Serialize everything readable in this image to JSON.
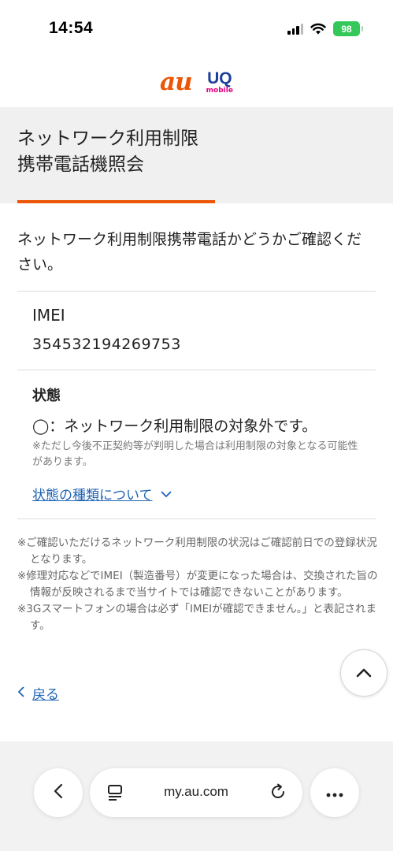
{
  "status_bar": {
    "time": "14:54",
    "battery": "98"
  },
  "header": {
    "au_logo": "au",
    "uq_logo": "UQ",
    "uq_sub": "mobile"
  },
  "page": {
    "title_line1": "ネットワーク利用制限",
    "title_line2": "携帯電話機照会",
    "intro": "ネットワーク利用制限携帯電話かどうかご確認ください。",
    "imei_label": "IMEI",
    "imei_value": "354532194269753",
    "state_label": "状態",
    "state_value": "◯：ネットワーク利用制限の対象外です。",
    "state_note": "※ただし今後不正契約等が判明した場合は利用制限の対象となる可能性があります。",
    "state_link": "状態の種類について",
    "notes": [
      "※ご確認いただけるネットワーク利用制限の状況はご確認前日での登録状況となります。",
      "※修理対応などでIMEI（製造番号）が変更になった場合は、交換された旨の情報が反映されるまで当サイトでは確認できないことがあります。",
      "※3Gスマートフォンの場合は必ず「IMEIが確認できません。」と表記されます。"
    ],
    "back_link": "戻る"
  },
  "browser": {
    "url": "my.au.com"
  },
  "colors": {
    "accent": "#eb5505",
    "link": "#1f63b4",
    "battery": "#34c759"
  }
}
